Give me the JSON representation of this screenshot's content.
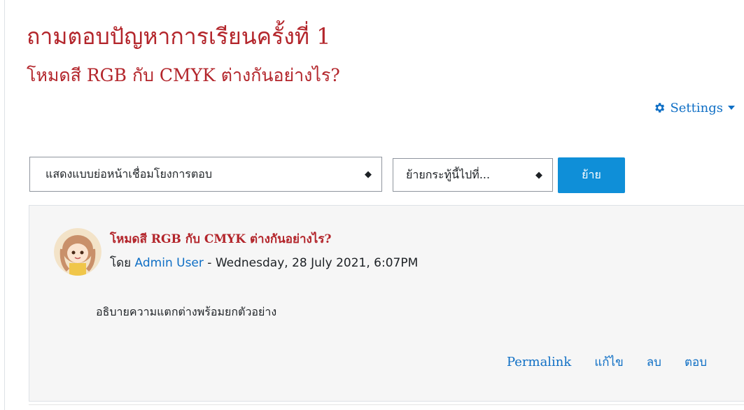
{
  "page": {
    "title": "ถามตอบปัญหาการเรียนครั้งที่ 1",
    "subtitle": "โหมดสี RGB กับ CMYK ต่างกันอย่างไร?"
  },
  "settings": {
    "label": "Settings",
    "icon": "gear-icon",
    "caret_icon": "caret-down-icon"
  },
  "controls": {
    "display_mode_selected": "แสดงแบบย่อหน้าเชื่อมโยงการตอบ",
    "move_select_selected": "ย้ายกระทู้นี้ไปที่...",
    "move_button_label": "ย้าย"
  },
  "post": {
    "subject": "โหมดสี RGB กับ CMYK ต่างกันอย่างไร?",
    "by_prefix": "โดย",
    "author": "Admin User",
    "date_separator": " - ",
    "date": "Wednesday, 28 July 2021, 6:07PM",
    "message": "อธิบายความแตกต่างพร้อมยกตัวอย่าง",
    "commands": {
      "permalink": "Permalink",
      "edit": "แก้ไข",
      "delete": "ลบ",
      "reply": "ตอบ"
    }
  },
  "colors": {
    "title": "#b3252b",
    "link": "#0f6fc5",
    "button": "#0f8fd8",
    "post_bg": "#f6f6f6"
  }
}
